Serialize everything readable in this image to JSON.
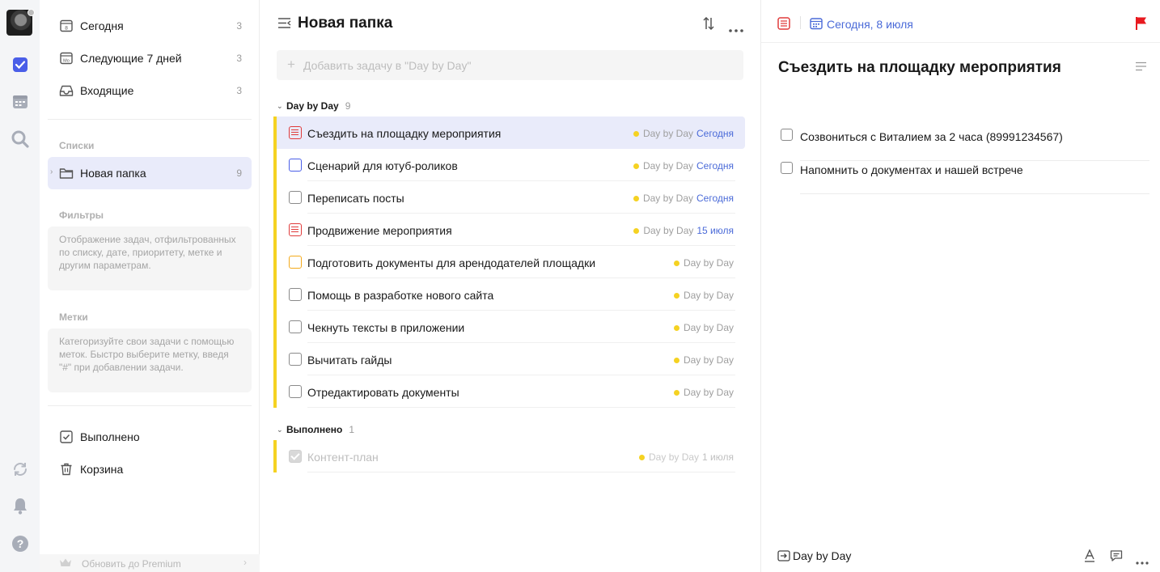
{
  "rail": {
    "icons": [
      "avatar",
      "checkbox-icon",
      "calendar-icon",
      "search-icon",
      "sync-icon",
      "bell-icon",
      "help-icon"
    ]
  },
  "sidebar": {
    "smart_lists": [
      {
        "label": "Сегодня",
        "count": "3",
        "icon": "calendar-today-icon"
      },
      {
        "label": "Следующие 7 дней",
        "count": "3",
        "icon": "calendar-week-icon"
      },
      {
        "label": "Входящие",
        "count": "3",
        "icon": "inbox-icon"
      }
    ],
    "lists_title": "Списки",
    "folder": {
      "label": "Новая папка",
      "count": "9"
    },
    "filters_title": "Фильтры",
    "filters_hint": "Отображение задач, отфильтрованных по списку, дате, приоритету, метке и другим параметрам.",
    "tags_title": "Метки",
    "tags_hint": "Категоризуйте свои задачи с помощью меток. Быстро выберите метку, введя \"#\" при добавлении задачи.",
    "completed_label": "Выполнено",
    "trash_label": "Корзина",
    "premium_label": "Обновить до Premium"
  },
  "main": {
    "title": "Новая папка",
    "add_placeholder": "Добавить задачу в \"Day by Day\"",
    "group": {
      "name": "Day by Day",
      "count": "9"
    },
    "tasks": [
      {
        "title": "Съездить на площадку мероприятия",
        "list": "Day by Day",
        "date": "Сегодня",
        "check": "red"
      },
      {
        "title": "Сценарий для ютуб-роликов",
        "list": "Day by Day",
        "date": "Сегодня",
        "check": "blue"
      },
      {
        "title": "Переписать посты",
        "list": "Day by Day",
        "date": "Сегодня",
        "check": "none"
      },
      {
        "title": "Продвижение мероприятия",
        "list": "Day by Day",
        "date": "15 июля",
        "check": "red"
      },
      {
        "title": "Подготовить документы для арендодателей площадки",
        "list": "Day by Day",
        "date": "",
        "check": "orange"
      },
      {
        "title": "Помощь в разработке нового сайта",
        "list": "Day by Day",
        "date": "",
        "check": "none"
      },
      {
        "title": "Чекнуть тексты в приложении",
        "list": "Day by Day",
        "date": "",
        "check": "none"
      },
      {
        "title": "Вычитать гайды",
        "list": "Day by Day",
        "date": "",
        "check": "none"
      },
      {
        "title": "Отредактировать документы",
        "list": "Day by Day",
        "date": "",
        "check": "none"
      }
    ],
    "done_group": {
      "name": "Выполнено",
      "count": "1"
    },
    "done_tasks": [
      {
        "title": "Контент-план",
        "list": "Day by Day",
        "date": "1 июля"
      }
    ]
  },
  "detail": {
    "date": "Сегодня, 8 июля",
    "title": "Съездить на площадку мероприятия",
    "subtasks": [
      {
        "text": "Созвониться с Виталием за 2 часа (89991234567)"
      },
      {
        "text": "Напомнить о документах и нашей встрече"
      }
    ],
    "footer_list": "Day by Day"
  },
  "colors": {
    "accent": "#4a6ad8",
    "list_bar": "#f5d222",
    "priority_high": "#e03b3b",
    "priority_medium": "#f4aa1b",
    "priority_low": "#4a5ee8",
    "flag": "#e8191f"
  }
}
